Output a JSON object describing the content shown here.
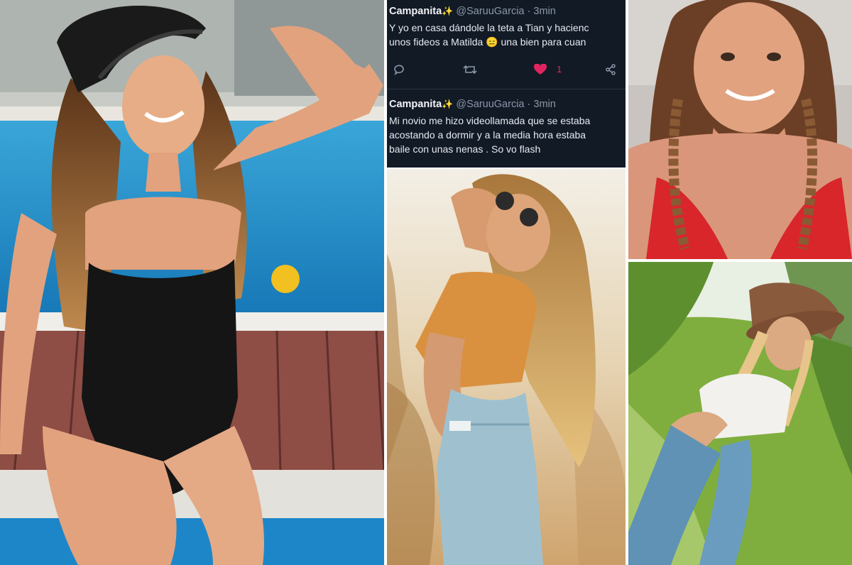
{
  "tweets": [
    {
      "name": "Campanita",
      "handle": "@SaruuGarcia",
      "time": "3min",
      "lines": [
        "Y yo en casa dándole la teta a Tian y hacienc",
        "unos fideos a Matilda 😑 una bien para cuan"
      ],
      "likes": "1"
    },
    {
      "name": "Campanita",
      "handle": "@SaruuGarcia",
      "time": "3min",
      "lines": [
        "Mi novio me hizo videollamada que se estaba",
        "acostando a dormir y a la media hora estaba",
        "baile con unas nenas . So vo flash"
      ]
    }
  ],
  "icons": {
    "spark": "sparkles-icon",
    "reply": "reply-icon",
    "retweet": "retweet-icon",
    "like": "heart-icon",
    "share": "share-icon"
  },
  "colors": {
    "tweet_bg": "#121a26",
    "like": "#e0245e",
    "muted": "#8b97a8"
  }
}
